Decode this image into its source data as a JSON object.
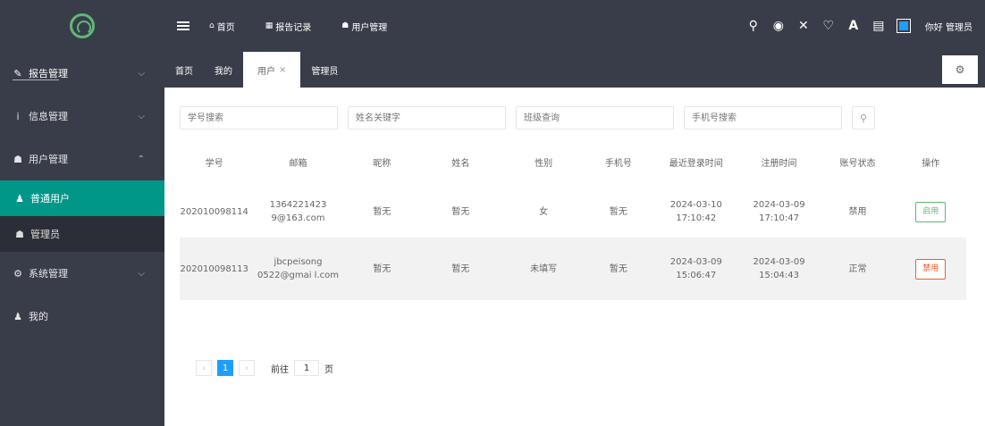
{
  "header": {
    "nav": [
      {
        "icon": "home-icon",
        "glyph": "⌂",
        "label": "首页"
      },
      {
        "icon": "table-icon",
        "glyph": "▦",
        "label": "报告记录"
      },
      {
        "icon": "users-icon",
        "glyph": "☗",
        "label": "用户管理"
      }
    ],
    "user_name": "你好 管理员"
  },
  "sidebar": {
    "items": [
      {
        "label": "报告管理",
        "icon": "edit-icon",
        "glyph": "✎",
        "arrow": "⌵"
      },
      {
        "label": "信息管理",
        "icon": "info-icon",
        "glyph": "i",
        "arrow": "⌵"
      },
      {
        "label": "用户管理",
        "icon": "group-icon",
        "glyph": "☗",
        "arrow": "⌃"
      },
      {
        "label": "系统管理",
        "icon": "cogs-icon",
        "glyph": "⚙",
        "arrow": "⌵"
      },
      {
        "label": "我的",
        "icon": "user-icon",
        "glyph": "♟"
      }
    ],
    "sub": [
      {
        "label": "普通用户",
        "glyph": "♟"
      },
      {
        "label": "管理员",
        "glyph": "☗"
      }
    ]
  },
  "tabs": [
    "首页",
    "我的",
    "用户",
    "管理员"
  ],
  "filters": {
    "placeholders": [
      "学号搜索",
      "姓名关键字",
      "班级查询",
      "手机号搜索"
    ]
  },
  "table": {
    "headers": [
      "学号",
      "邮箱",
      "昵称",
      "姓名",
      "性别",
      "手机号",
      "最近登录时间",
      "注册时间",
      "账号状态",
      "操作"
    ],
    "rows": [
      [
        "202010098114",
        "1364221423 9@163.com",
        "暂无",
        "暂无",
        "女",
        "暂无",
        "2024-03-10 17:10:42",
        "2024-03-09 17:10:47",
        "禁用",
        "启用"
      ],
      [
        "202010098113",
        "jbcpeisong 0522@gmai l.com",
        "暂无",
        "暂无",
        "未填写",
        "暂无",
        "2024-03-09 15:06:47",
        "2024-03-09 15:04:43",
        "正常",
        "禁用"
      ]
    ]
  },
  "pager": {
    "prev": "‹",
    "current": "1",
    "next": "›",
    "goto_label": "前往",
    "goto_value": "1",
    "page_unit": "页"
  }
}
